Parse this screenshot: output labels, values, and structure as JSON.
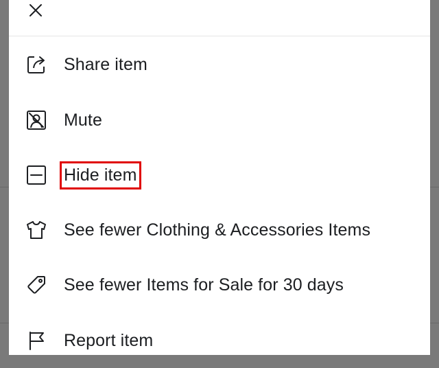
{
  "sheet": {
    "close_icon": "close-icon",
    "items": [
      {
        "icon": "share-icon",
        "label": "Share item"
      },
      {
        "icon": "mute-icon",
        "label": "Mute"
      },
      {
        "icon": "hide-icon",
        "label": "Hide item",
        "highlighted": true,
        "highlight_color": "#e00000"
      },
      {
        "icon": "shirt-icon",
        "label": "See fewer Clothing & Accessories Items"
      },
      {
        "icon": "tag-icon",
        "label": "See fewer Items for Sale for 30 days"
      },
      {
        "icon": "flag-icon",
        "label": "Report item"
      }
    ]
  },
  "colors": {
    "sheet_background": "#ffffff",
    "text": "#1c1e21",
    "backdrop": "#7a7a7a",
    "highlight": "#e00000"
  }
}
